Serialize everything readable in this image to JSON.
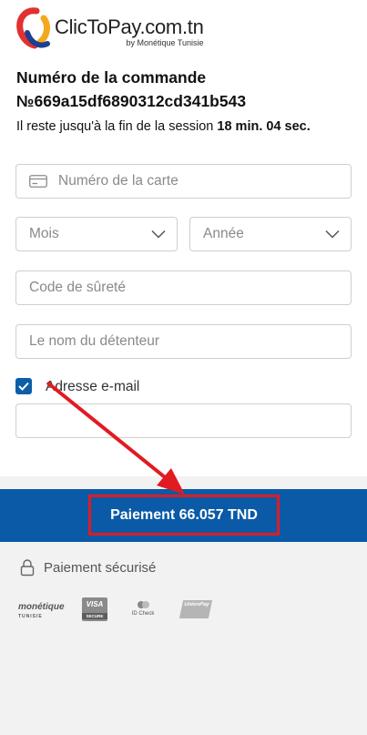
{
  "header": {
    "brand": "ClicToPay",
    "brand_tld": ".com.tn",
    "subtitle": "by Monétique Tunisie"
  },
  "order": {
    "title": "Numéro de la commande №669a15df6890312cd341b543"
  },
  "session": {
    "prefix": "Il reste jusqu'à la fin de la session ",
    "time": "18 min. 04 sec."
  },
  "form": {
    "card_placeholder": "Numéro de la carte",
    "month_placeholder": "Mois",
    "year_placeholder": "Année",
    "cvv_placeholder": "Code de sûreté",
    "holder_placeholder": "Le nom du détenteur",
    "email_checkbox_label": "Adresse e-mail",
    "email_checked": true,
    "email_value": ""
  },
  "payment": {
    "button_label": "Paiement 66.057 TND"
  },
  "footer": {
    "secure_label": "Paiement sécurisé",
    "logos": {
      "monetique": "monétique",
      "monetique_sub": "TUNISIE",
      "visa": "VISA",
      "visa_sub": "SECURE",
      "idcheck": "ID Check",
      "unionpay": "UnionPay"
    }
  },
  "colors": {
    "primary": "#0a5aa7",
    "annotation_red": "#e11b22",
    "footer_bg": "#f2f2f2"
  }
}
